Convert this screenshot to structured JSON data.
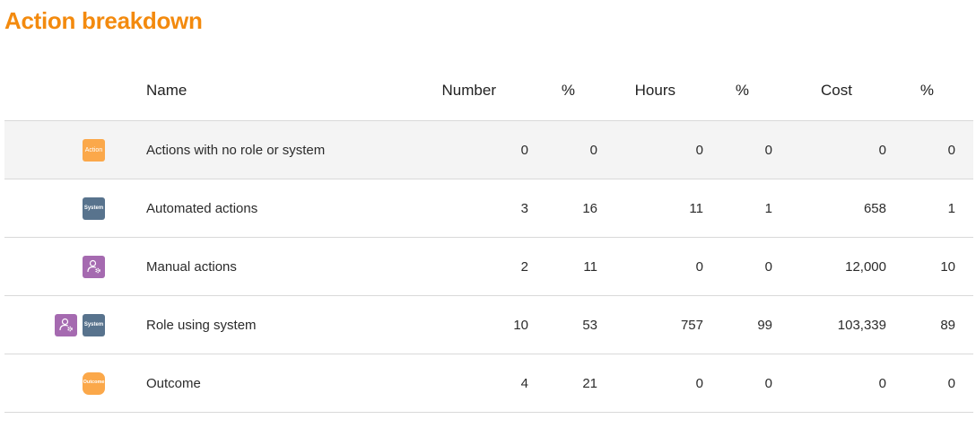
{
  "title": "Action breakdown",
  "columns": {
    "name": "Name",
    "number": "Number",
    "number_pct": "%",
    "hours": "Hours",
    "hours_pct": "%",
    "cost": "Cost",
    "cost_pct": "%"
  },
  "badges": {
    "action": "Action",
    "system": "System",
    "outcome": "Outcome"
  },
  "colors": {
    "title": "#f38a0e",
    "action_badge": "#fba84a",
    "system_badge": "#58738d",
    "role_badge": "#a56ab0",
    "outcome_badge": "#fba84a",
    "highlight_row": "#f4f4f4"
  },
  "rows": [
    {
      "name": "Actions with no role or system",
      "icons": [
        "action-badge"
      ],
      "number": "0",
      "number_pct": "0",
      "hours": "0",
      "hours_pct": "0",
      "cost": "0",
      "cost_pct": "0"
    },
    {
      "name": "Automated actions",
      "icons": [
        "system-badge"
      ],
      "number": "3",
      "number_pct": "16",
      "hours": "11",
      "hours_pct": "1",
      "cost": "658",
      "cost_pct": "1"
    },
    {
      "name": "Manual actions",
      "icons": [
        "role-icon"
      ],
      "number": "2",
      "number_pct": "11",
      "hours": "0",
      "hours_pct": "0",
      "cost": "12,000",
      "cost_pct": "10"
    },
    {
      "name": "Role using system",
      "icons": [
        "role-icon",
        "system-badge"
      ],
      "number": "10",
      "number_pct": "53",
      "hours": "757",
      "hours_pct": "99",
      "cost": "103,339",
      "cost_pct": "89"
    },
    {
      "name": "Outcome",
      "icons": [
        "outcome-badge"
      ],
      "number": "4",
      "number_pct": "21",
      "hours": "0",
      "hours_pct": "0",
      "cost": "0",
      "cost_pct": "0"
    }
  ]
}
